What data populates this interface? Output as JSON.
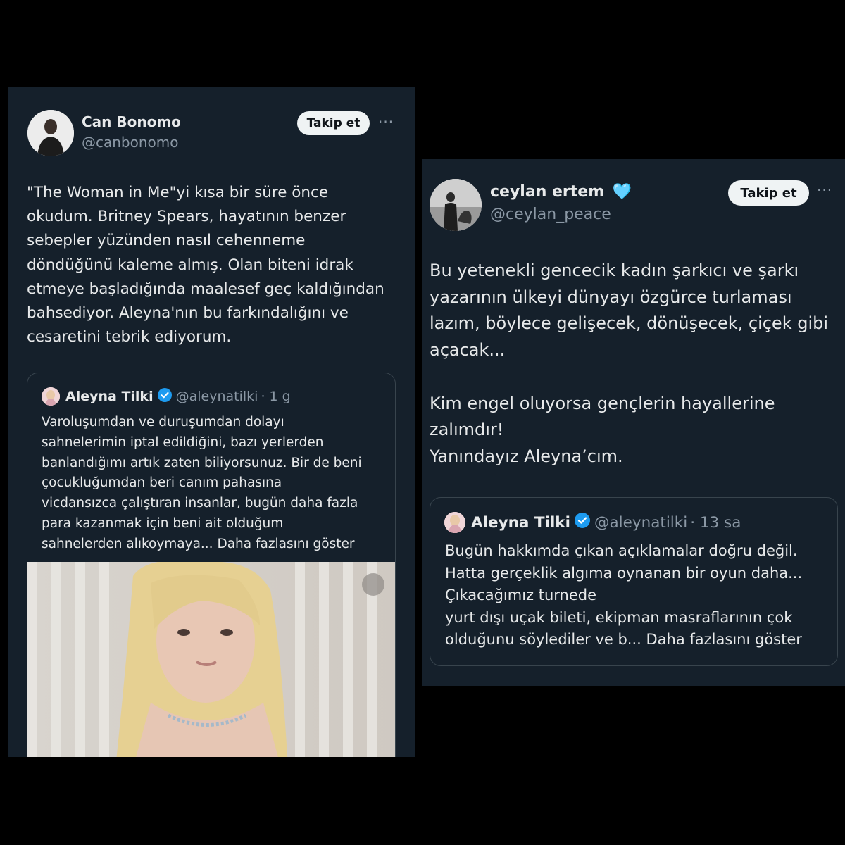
{
  "tweet1": {
    "author_name": "Can Bonomo",
    "author_handle": "@canbonomo",
    "follow_label": "Takip et",
    "more_label": "···",
    "text": "\"The Woman in Me\"yi kısa bir süre önce\nokudum. Britney Spears, hayatının benzer\nsebepler yüzünden nasıl cehenneme\ndöndüğünü kaleme almış. Olan biteni idrak\netmeye başladığında maalesef geç kaldığından\nbahsediyor. Aleyna'nın bu farkındalığını ve\ncesaretini tebrik ediyorum.",
    "quote": {
      "author_name": "Aleyna Tilki",
      "author_handle": "@aleynatilki",
      "time": "· 1 g",
      "text": "Varoluşumdan ve duruşumdan dolayı\nsahnelerimin iptal edildiğini, bazı yerlerden\nbanlandığımı artık zaten biliyorsunuz. Bir de beni\nçocukluğumdan beri canım pahasına\nvicdansızca çalıştıran insanlar, bugün daha fazla\npara kazanmak için beni ait olduğum\nsahnelerden alıkoymaya... Daha fazlasını göster"
    }
  },
  "tweet2": {
    "author_name": "ceylan ertem",
    "author_emoji": "🩵",
    "author_handle": "@ceylan_peace",
    "follow_label": "Takip et",
    "more_label": "···",
    "text": "Bu yetenekli gencecik kadın şarkıcı ve şarkı\nyazarının ülkeyi dünyayı özgürce turlaması\nlazım, böylece gelişecek, dönüşecek, çiçek gibi\naçacak...\n\nKim engel oluyorsa gençlerin hayallerine\nzalımdır!\nYanındayız Aleyna’cım.",
    "quote": {
      "author_name": "Aleyna Tilki",
      "author_handle": "@aleynatilki",
      "time": "· 13 sa",
      "text": "Bugün hakkımda çıkan açıklamalar doğru değil.\nHatta gerçeklik algıma oynanan bir oyun daha...\nÇıkacağımız turnede\nyurt dışı uçak bileti, ekipman masraflarının çok\nolduğunu söylediler ve b... Daha fazlasını göster"
    }
  },
  "colors": {
    "card_bg": "#15202b",
    "verified_blue": "#1d9bf0",
    "muted_text": "#8b98a5"
  }
}
